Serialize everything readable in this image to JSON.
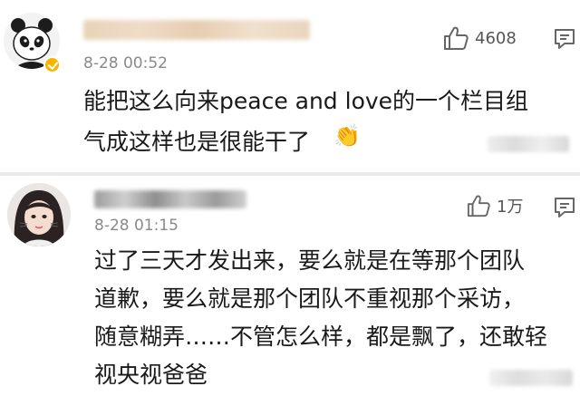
{
  "comments": [
    {
      "time": "8-28 00:52",
      "likes": "4608",
      "verified": true,
      "avatar": "panda-avatar",
      "text": [
        "能把这么向来peace and love的一个栏目组",
        "气成这样也是很能干了"
      ],
      "emoji": "👏",
      "emoji_name": "clapping-hands"
    },
    {
      "time": "8-28 01:15",
      "likes": "1万",
      "avatar": "girl-avatar",
      "text": [
        "过了三天才发出来，要么就是在等那个团队",
        "道歉，要么就是那个团队不重视那个采访，",
        "随意糊弄……不管怎么样，都是飘了，还敢轻",
        "视央视爸爸"
      ]
    }
  ],
  "icons": {
    "like": "thumbs-up-icon",
    "reply": "comment-icon",
    "verified": "verified-badge-icon"
  },
  "colors": {
    "time": "#8a8a8a",
    "text": "#1a1a1a",
    "verified_badge": "#f7b500",
    "separator": "#e9e9e9"
  }
}
